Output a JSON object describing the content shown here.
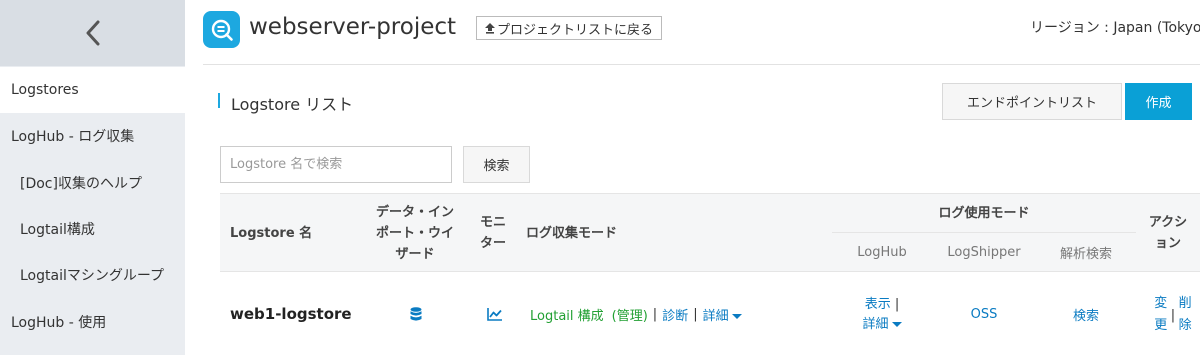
{
  "sidebar": {
    "items": [
      {
        "label": "Logstores"
      },
      {
        "label": "LogHub - ログ収集"
      },
      {
        "label": "[Doc]収集のヘルプ"
      },
      {
        "label": "Logtail構成"
      },
      {
        "label": "Logtailマシングループ"
      },
      {
        "label": "LogHub - 使用"
      }
    ]
  },
  "header": {
    "project_name": "webserver-project",
    "back_label": "プロジェクトリストに戻る",
    "region": "リージョン : Japan (Tokyo"
  },
  "section": {
    "title": "Logstore リスト",
    "endpoint_button": "エンドポイントリスト",
    "create_button": "作成"
  },
  "search": {
    "placeholder": "Logstore 名で検索",
    "button": "検索"
  },
  "table": {
    "headers": {
      "name": "Logstore 名",
      "wizard": "データ・インポート・ウイザード",
      "monitor": "モニター",
      "collect_mode": "ログ収集モード",
      "use_mode": "ログ使用モード",
      "loghub": "LogHub",
      "logshipper": "LogShipper",
      "analysis": "解析検索",
      "action": "アクション"
    },
    "rows": [
      {
        "name": "web1-logstore",
        "logtail_config": "Logtail 構成",
        "manage": "(管理)",
        "diagnose": "診断",
        "detail": "詳細",
        "show": "表示",
        "loghub_detail": "詳細",
        "oss": "OSS",
        "search": "検索",
        "change": "変更",
        "delete": "削除"
      }
    ]
  },
  "colors": {
    "accent": "#1da8e0",
    "link": "#0a7bc2",
    "green": "#22a033",
    "sidebar_bg": "#eaedf1"
  }
}
